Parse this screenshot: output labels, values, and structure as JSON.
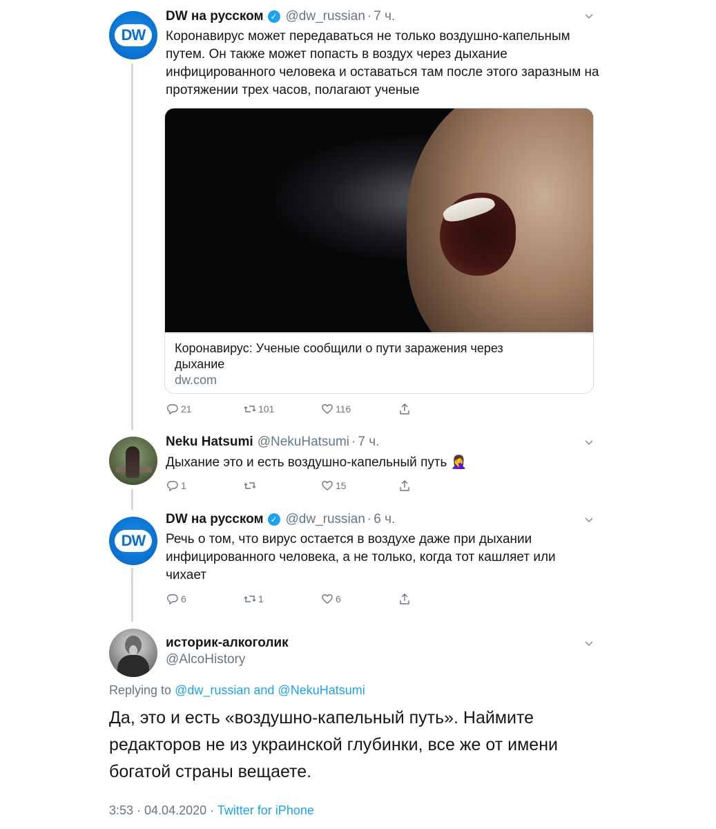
{
  "tweets": [
    {
      "name": "DW на русском",
      "handle": "@dw_russian",
      "time": "7 ч.",
      "text": "Коронавирус может передаваться не только воздушно-капельным путем. Он также может попасть в воздух через дыхание инфицированного человека и оставаться там после этого заразным на протяжении трех часов, полагают ученые",
      "card": {
        "title": "Коронавирус: Ученые сообщили о пути заражения через дыхание",
        "domain": "dw.com"
      },
      "counts": {
        "replies": "21",
        "retweets": "101",
        "likes": "116"
      }
    },
    {
      "name": "Neku Hatsumi",
      "handle": "@NekuHatsumi",
      "time": "7 ч.",
      "text": "Дыхание это и есть воздушно-капельный путь 🤦‍♀️",
      "counts": {
        "replies": "1",
        "retweets": "",
        "likes": "15"
      }
    },
    {
      "name": "DW на русском",
      "handle": "@dw_russian",
      "time": "6 ч.",
      "text": "Речь о том, что вирус остается в воздухе даже при дыхании инфицированного человека, а не только, когда тот кашляет или чихает",
      "counts": {
        "replies": "6",
        "retweets": "1",
        "likes": "6"
      }
    }
  ],
  "main_tweet": {
    "name": "историк-алкоголик",
    "handle": "@AlcoHistory",
    "replying_prefix": "Replying to",
    "replying_to": "@dw_russian and @NekuHatsumi",
    "text": "Да, это и есть «воздушно-капельный путь». Наймите редакторов не из украинской глубинки, все же от имени богатой страны вещаете.",
    "timestamp": "3:53 · 04.04.2020 · ",
    "source": "Twitter for iPhone"
  },
  "avatar_logo_text": "DW",
  "colors": {
    "link": "#1da1f2",
    "secondary_text": "#657786",
    "thread_line": "#cfd9de",
    "dw_blue": "#0a6fd0"
  },
  "icons": [
    "chevron-down-icon",
    "verified-badge-icon",
    "reply-icon",
    "retweet-icon",
    "like-icon",
    "share-icon"
  ]
}
